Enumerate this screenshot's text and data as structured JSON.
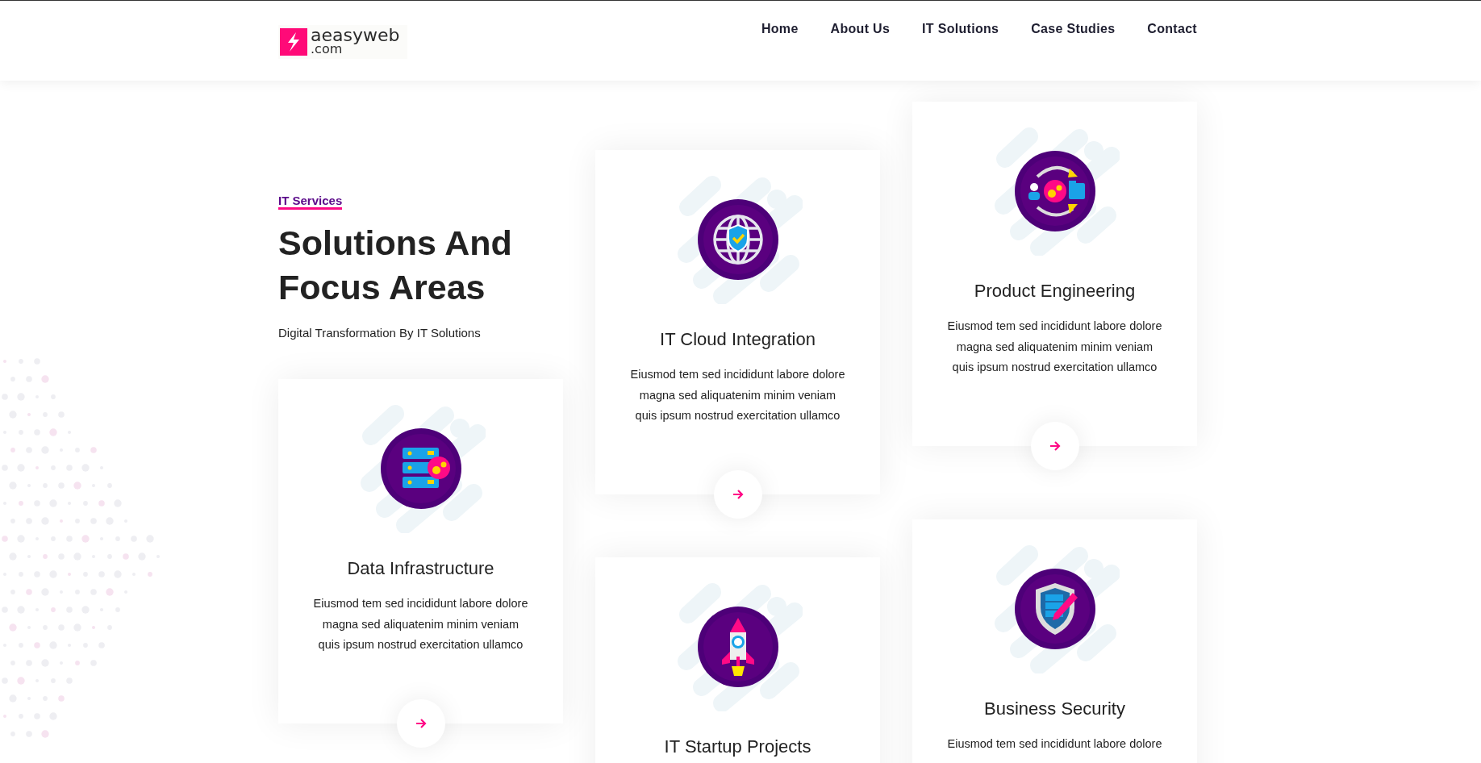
{
  "header": {
    "logo": {
      "name": "aeasyweb",
      "domain": ".com"
    },
    "nav": [
      {
        "label": "Home"
      },
      {
        "label": "About Us"
      },
      {
        "label": "IT Solutions"
      },
      {
        "label": "Case Studies"
      },
      {
        "label": "Contact"
      }
    ]
  },
  "intro": {
    "eyebrow": "IT Services",
    "heading": "Solutions And Focus Areas",
    "subtitle": "Digital Transformation By IT Solutions"
  },
  "columns": [
    {
      "cards": [
        {
          "title": "Data Infrastructure",
          "description": "Eiusmod tem sed incididunt labore dolore magna sed aliquatenim minim veniam quis ipsum nostrud exercitation ullamco",
          "arrow_button": true
        }
      ]
    },
    {
      "cards": [
        {
          "title": "IT Cloud Integration",
          "description": "Eiusmod tem sed incididunt labore dolore magna sed aliquatenim minim veniam quis ipsum nostrud exercitation ullamco",
          "arrow_button": true
        },
        {
          "title": "IT Startup Projects",
          "arrow_button": false
        }
      ]
    },
    {
      "cards": [
        {
          "title": "Product Engineering",
          "description": "Eiusmod tem sed incididunt labore dolore magna sed aliquatenim minim veniam quis ipsum nostrud exercitation ullamco",
          "arrow_button": true
        },
        {
          "title": "Business Security",
          "description": "Eiusmod tem sed incididunt labore dolore",
          "arrow_button": false
        }
      ]
    }
  ]
}
